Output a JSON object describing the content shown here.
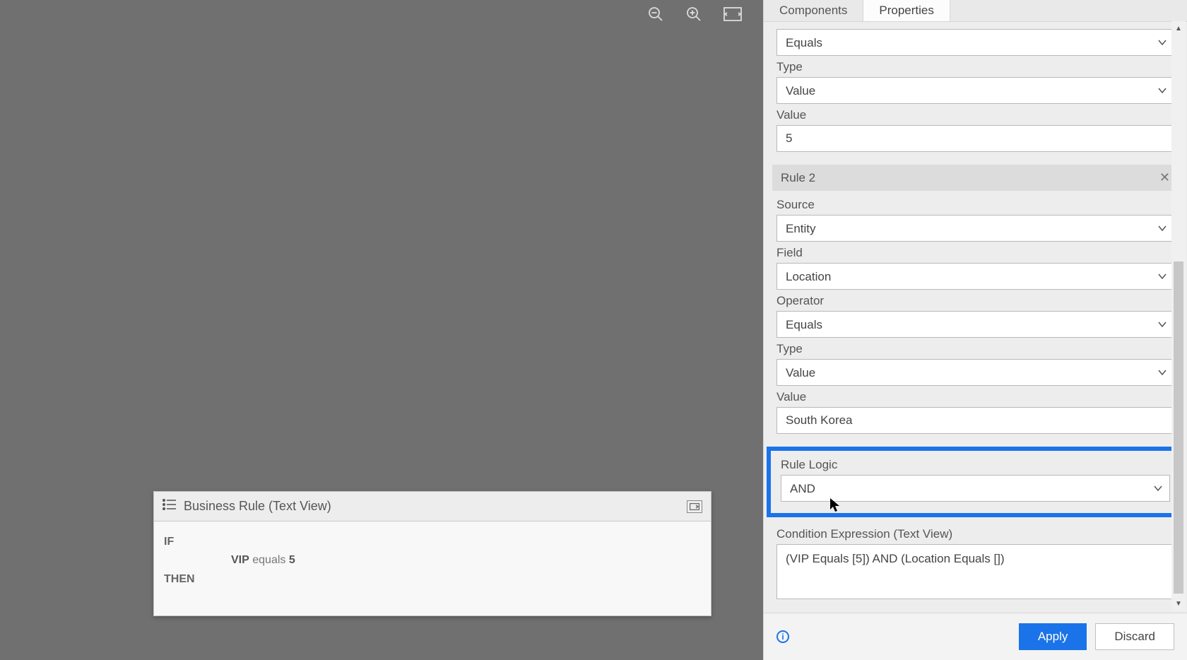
{
  "tabs": {
    "components": "Components",
    "properties": "Properties"
  },
  "rule1": {
    "operator_value": "Equals",
    "type_label": "Type",
    "type_value": "Value",
    "value_label": "Value",
    "value_value": "5"
  },
  "rule2": {
    "header": "Rule 2",
    "source_label": "Source",
    "source_value": "Entity",
    "field_label": "Field",
    "field_value": "Location",
    "operator_label": "Operator",
    "operator_value": "Equals",
    "type_label": "Type",
    "type_value": "Value",
    "value_label": "Value",
    "value_value": "South Korea"
  },
  "rule_logic": {
    "label": "Rule Logic",
    "value": "AND"
  },
  "cond_expr": {
    "label": "Condition Expression (Text View)",
    "value": "(VIP Equals [5]) AND (Location Equals [])"
  },
  "footer": {
    "apply": "Apply",
    "discard": "Discard"
  },
  "text_view": {
    "title": "Business Rule (Text View)",
    "kw_if": "IF",
    "cond_field": "VIP",
    "cond_op": "equals",
    "cond_val": "5",
    "kw_then": "THEN"
  }
}
